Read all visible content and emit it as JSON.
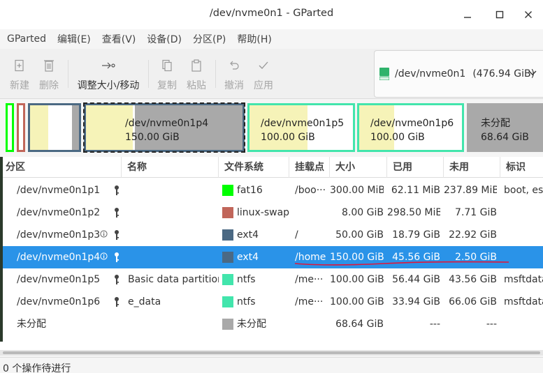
{
  "window": {
    "title": "/dev/nvme0n1 - GParted"
  },
  "menu": [
    "GParted",
    "编辑(E)",
    "查看(V)",
    "设备(D)",
    "分区(P)",
    "帮助(H)"
  ],
  "toolbar": {
    "new": "新建",
    "delete": "删除",
    "resize": "调整大小/移动",
    "copy": "复制",
    "paste": "粘贴",
    "undo": "撤消",
    "apply": "应用"
  },
  "device": {
    "name": "/dev/nvme0n1",
    "size": "(476.94 GiB)"
  },
  "map": {
    "p4": {
      "name": "/dev/nvme0n1p4",
      "size": "150.00 GiB",
      "used_fraction": 0.3
    },
    "p5": {
      "name": "/dev/nvme0n1p5",
      "size": "100.00 GiB",
      "used_fraction": 0.56
    },
    "p6": {
      "name": "/dev/nvme0n1p6",
      "size": "100.00 GiB",
      "used_fraction": 0.34
    },
    "unalloc": {
      "name": "未分配",
      "size": "68.64 GiB"
    }
  },
  "columns": [
    "分区",
    "名称",
    "文件系统",
    "挂载点",
    "大小",
    "已用",
    "未用",
    "标识"
  ],
  "rows": [
    {
      "partition": "/dev/nvme0n1p1",
      "name": "",
      "fs": "fat16",
      "fs_color": "#00ff00",
      "mount": "/boo···",
      "size": "300.00 MiB",
      "used": "62.11 MiB",
      "unused": "237.89 MiB",
      "flags": "boot, esp"
    },
    {
      "partition": "/dev/nvme0n1p2",
      "name": "",
      "fs": "linux-swap",
      "fs_color": "#c1665a",
      "mount": "",
      "size": "8.00 GiB",
      "used": "298.50 MiB",
      "unused": "7.71 GiB",
      "flags": ""
    },
    {
      "partition": "/dev/nvme0n1p3",
      "name": "",
      "fs": "ext4",
      "fs_color": "#4b6983",
      "mount": "/",
      "size": "50.00 GiB",
      "used": "18.79 GiB",
      "unused": "22.92 GiB",
      "flags": ""
    },
    {
      "partition": "/dev/nvme0n1p4",
      "name": "",
      "fs": "ext4",
      "fs_color": "#4b6983",
      "mount": "/home",
      "size": "150.00 GiB",
      "used": "45.56 GiB",
      "unused": "2.50 GiB",
      "flags": ""
    },
    {
      "partition": "/dev/nvme0n1p5",
      "name": "Basic data partition",
      "fs": "ntfs",
      "fs_color": "#42e5ac",
      "mount": "/me···",
      "size": "100.00 GiB",
      "used": "56.44 GiB",
      "unused": "43.56 GiB",
      "flags": "msftdata"
    },
    {
      "partition": "/dev/nvme0n1p6",
      "name": "e_data",
      "fs": "ntfs",
      "fs_color": "#42e5ac",
      "mount": "/me···",
      "size": "100.00 GiB",
      "used": "33.94 GiB",
      "unused": "66.06 GiB",
      "flags": "msftdata"
    },
    {
      "partition": "未分配",
      "name": "",
      "fs": "未分配",
      "fs_color": "#a9a9a9",
      "mount": "",
      "size": "68.64 GiB",
      "used": "---",
      "unused": "---",
      "flags": ""
    }
  ],
  "status": "0 个操作待进行"
}
